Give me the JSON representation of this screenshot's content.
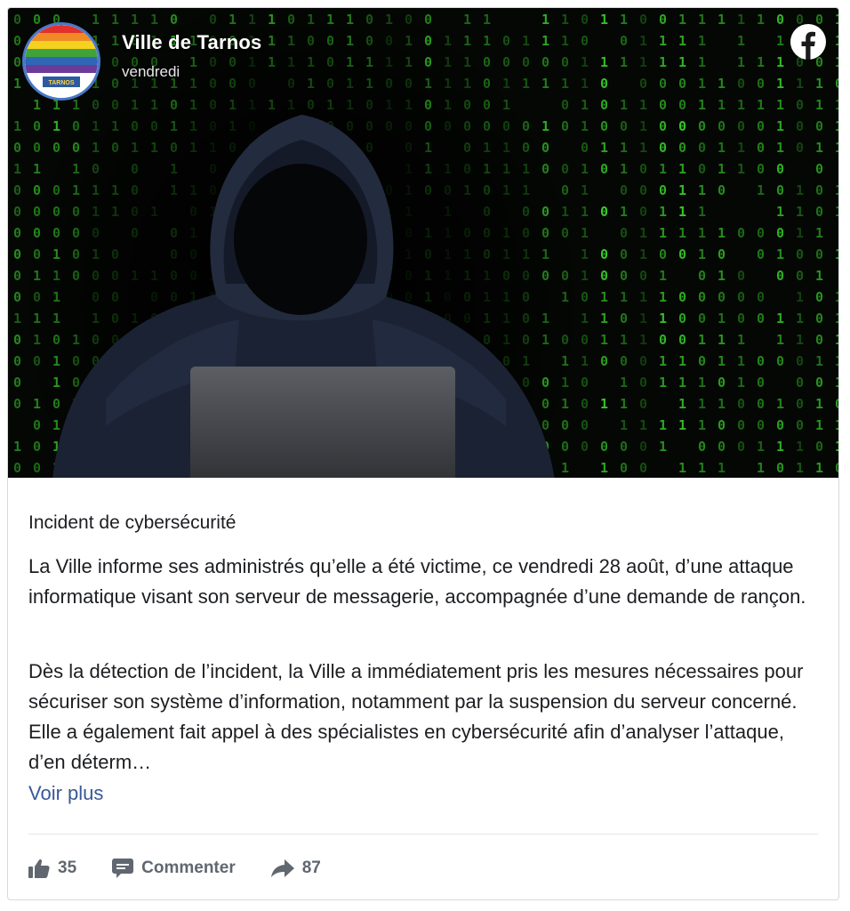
{
  "post": {
    "page_name": "Ville de Tarnos",
    "timestamp": "vendredi",
    "avatar_text": "TARNOS",
    "title": "Incident de cybersécurité",
    "paragraph1": "La Ville informe ses administrés qu’elle a été victime, ce vendredi 28 août, d’une attaque informatique visant son serveur de messagerie, accompagnée d’une demande de rançon.",
    "paragraph2": "Dès la détection de l’incident, la Ville a immédiatement pris les mesures nécessaires pour sécuriser son système d’information, notamment par la suspension du serveur concerné. Elle a également fait appel à des spécialistes en cybersécurité afin d’analyser l’attaque, d’en déterm…",
    "see_more": "Voir plus"
  },
  "actions": {
    "like_count": "35",
    "comment_label": "Commenter",
    "share_count": "87"
  },
  "icons": {
    "facebook": "facebook-logo-icon",
    "like": "thumbs-up-icon",
    "comment": "comment-bubble-icon",
    "share": "share-arrow-icon"
  },
  "colors": {
    "matrix_green": "#39d12b",
    "link_blue": "#385898",
    "action_gray": "#606770",
    "avatar_ring": "#4a78c7",
    "hoodie": "#1b2233"
  }
}
